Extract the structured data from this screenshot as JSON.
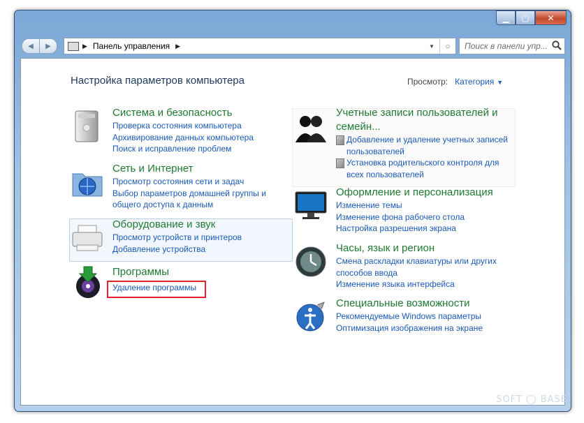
{
  "window": {
    "address": {
      "path": "Панель управления"
    },
    "search": {
      "placeholder": "Поиск в панели упр..."
    }
  },
  "page": {
    "title": "Настройка параметров компьютера",
    "view_label": "Просмотр:",
    "view_value": "Категория"
  },
  "categories": [
    {
      "title": "Система и безопасность",
      "links": [
        "Проверка состояния компьютера",
        "Архивирование данных компьютера",
        "Поиск и исправление проблем"
      ]
    },
    {
      "title": "Сеть и Интернет",
      "links": [
        "Просмотр состояния сети и задач",
        "Выбор параметров домашней группы и",
        "общего доступа к данным"
      ]
    },
    {
      "title": "Оборудование и звук",
      "links": [
        "Просмотр устройств и принтеров",
        "Добавление устройства"
      ]
    },
    {
      "title": "Программы",
      "links": [
        "Удаление программы"
      ]
    },
    {
      "title_line1": "Учетные записи пользователей и",
      "title_line2": "семейн...",
      "links": [
        "Добавление и удаление учетных записей",
        "пользователей",
        "Установка родительского контроля для",
        "всех пользователей"
      ]
    },
    {
      "title": "Оформление и персонализация",
      "links": [
        "Изменение темы",
        "Изменение фона рабочего стола",
        "Настройка разрешения экрана"
      ]
    },
    {
      "title": "Часы, язык и регион",
      "links": [
        "Смена раскладки клавиатуры или других",
        "способов ввода",
        "Изменение языка интерфейса"
      ]
    },
    {
      "title": "Специальные возможности",
      "links": [
        "Рекомендуемые Windows параметры",
        "Оптимизация изображения на экране"
      ]
    }
  ],
  "watermark": "SOFT ◯ BASE"
}
